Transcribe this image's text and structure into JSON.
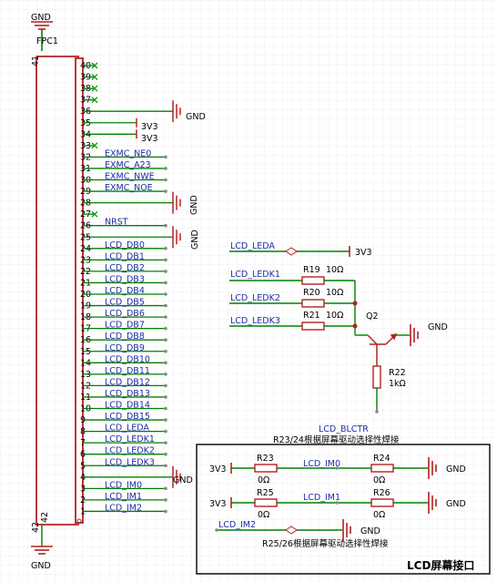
{
  "colors": {
    "wire": "#008000",
    "body": "#b22222",
    "net": "#1f2aa8",
    "grid": "#dcdcdc",
    "noconnect": "#00a000",
    "text": "#000000"
  },
  "title": "LCD屏幕接口",
  "connector": {
    "designator": "FPC1",
    "gnd_top": "GND",
    "gnd_bottom": "GND",
    "pin_41": "41",
    "pin_42_left": "42",
    "pin_42_right": "42",
    "pins": [
      {
        "num": "40",
        "net": "",
        "nc": true
      },
      {
        "num": "39",
        "net": "",
        "nc": true
      },
      {
        "num": "38",
        "net": "",
        "nc": true
      },
      {
        "num": "37",
        "net": "",
        "nc": true
      },
      {
        "num": "36",
        "net": "",
        "power": "GND"
      },
      {
        "num": "35",
        "net": "",
        "power": "3V3"
      },
      {
        "num": "34",
        "net": "",
        "power": "3V3"
      },
      {
        "num": "33",
        "net": "",
        "nc": true
      },
      {
        "num": "32",
        "net": "EXMC_NE0"
      },
      {
        "num": "31",
        "net": "EXMC_A23"
      },
      {
        "num": "30",
        "net": "EXMC_NWE"
      },
      {
        "num": "29",
        "net": "EXMC_NOE"
      },
      {
        "num": "28",
        "net": "",
        "power": "GND"
      },
      {
        "num": "27",
        "net": "",
        "nc": true
      },
      {
        "num": "26",
        "net": "NRST"
      },
      {
        "num": "25",
        "net": "",
        "power": "GND"
      },
      {
        "num": "24",
        "net": "LCD_DB0"
      },
      {
        "num": "23",
        "net": "LCD_DB1"
      },
      {
        "num": "22",
        "net": "LCD_DB2"
      },
      {
        "num": "21",
        "net": "LCD_DB3"
      },
      {
        "num": "20",
        "net": "LCD_DB4"
      },
      {
        "num": "19",
        "net": "LCD_DB5"
      },
      {
        "num": "18",
        "net": "LCD_DB6"
      },
      {
        "num": "17",
        "net": "LCD_DB7"
      },
      {
        "num": "16",
        "net": "LCD_DB8"
      },
      {
        "num": "15",
        "net": "LCD_DB9"
      },
      {
        "num": "14",
        "net": "LCD_DB10"
      },
      {
        "num": "13",
        "net": "LCD_DB11"
      },
      {
        "num": "12",
        "net": "LCD_DB12"
      },
      {
        "num": "11",
        "net": "LCD_DB13"
      },
      {
        "num": "10",
        "net": "LCD_DB14"
      },
      {
        "num": "9",
        "net": "LCD_DB15"
      },
      {
        "num": "8",
        "net": "LCD_LEDA"
      },
      {
        "num": "7",
        "net": "LCD_LEDK1"
      },
      {
        "num": "6",
        "net": "LCD_LEDK2"
      },
      {
        "num": "5",
        "net": "LCD_LEDK3"
      },
      {
        "num": "4",
        "net": "",
        "power": "GND"
      },
      {
        "num": "3",
        "net": "LCD_IM0"
      },
      {
        "num": "2",
        "net": "LCD_IM1"
      },
      {
        "num": "1",
        "net": "LCD_IM2"
      }
    ],
    "gnd_labels": [
      "GND",
      "GND",
      "GND",
      "GND"
    ],
    "v33_labels": [
      "3V3",
      "3V3"
    ]
  },
  "backlight": {
    "leda": "LCD_LEDA",
    "leda_power": "3V3",
    "ledk1": "LCD_LEDK1",
    "ledk2": "LCD_LEDK2",
    "ledk3": "LCD_LEDK3",
    "r19": "R19",
    "r19_val": "10Ω",
    "r20": "R20",
    "r20_val": "10Ω",
    "r21": "R21",
    "r21_val": "10Ω",
    "q2": "Q2",
    "q2_gnd": "GND",
    "r22": "R22",
    "r22_val": "1kΩ",
    "blctr": "LCD_BLCTR"
  },
  "im_select": {
    "note_top": "R23/24根据屏幕驱动选择性焊接",
    "note_bottom": "R25/26根据屏幕驱动选择性焊接",
    "row1": {
      "left_power": "3V3",
      "r_left": "R23",
      "r_left_val": "0Ω",
      "net": "LCD_IM0",
      "r_right": "R24",
      "r_right_val": "0Ω",
      "gnd": "GND"
    },
    "row2": {
      "left_power": "3V3",
      "r_left": "R25",
      "r_left_val": "0Ω",
      "net": "LCD_IM1",
      "r_right": "R26",
      "r_right_val": "0Ω",
      "gnd": "GND"
    },
    "im2_net": "LCD_IM2",
    "im2_gnd": "GND"
  }
}
